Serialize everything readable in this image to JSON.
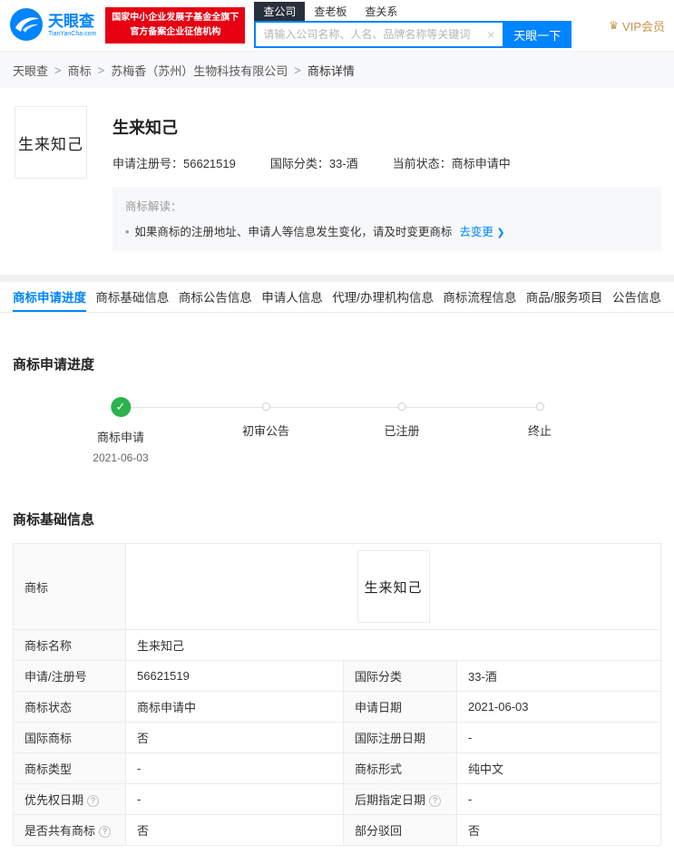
{
  "colors": {
    "brand_blue": "#0084ff",
    "badge_red": "#e60012",
    "vip_gold": "#c8954b",
    "success_green": "#2bb24c",
    "link_blue": "#0084ff"
  },
  "header": {
    "logo": {
      "name": "天眼查",
      "domain": "TianYanCha.com"
    },
    "badge": {
      "line1": "国家中小企业发展子基金全旗下",
      "line2": "官方备案企业征信机构"
    },
    "search": {
      "tabs": [
        {
          "label": "查公司"
        },
        {
          "label": "查老板"
        },
        {
          "label": "查关系"
        }
      ],
      "placeholder": "请输入公司名称、人名、品牌名称等关键词",
      "clear_icon": "×",
      "button": "天眼一下"
    },
    "vip": {
      "icon": "♛",
      "label": "VIP会员"
    }
  },
  "breadcrumb": {
    "separator": ">",
    "items": [
      {
        "label": "天眼查"
      },
      {
        "label": "商标"
      },
      {
        "label": "苏梅香（苏州）生物科技有限公司"
      },
      {
        "label": "商标详情"
      }
    ]
  },
  "summary": {
    "thumb_text": "生来知己",
    "title": "生来知己",
    "meta": [
      {
        "label": "申请注册号：",
        "value": "56621519"
      },
      {
        "label": "国际分类：",
        "value": "33-酒"
      },
      {
        "label": "当前状态：",
        "value": "商标申请中"
      }
    ],
    "tip": {
      "title": "商标解读：",
      "bullet": "•",
      "text": "如果商标的注册地址、申请人等信息发生变化，请及时变更商标",
      "link": "去变更",
      "link_arrow": "❯"
    }
  },
  "tabs": [
    {
      "label": "商标申请进度"
    },
    {
      "label": "商标基础信息"
    },
    {
      "label": "商标公告信息"
    },
    {
      "label": "申请人信息"
    },
    {
      "label": "代理/办理机构信息"
    },
    {
      "label": "商标流程信息"
    },
    {
      "label": "商品/服务项目"
    },
    {
      "label": "公告信息"
    }
  ],
  "progress": {
    "section_title": "商标申请进度",
    "check_glyph": "✓",
    "steps": [
      {
        "label": "商标申请",
        "date": "2021-06-03"
      },
      {
        "label": "初审公告",
        "date": ""
      },
      {
        "label": "已注册",
        "date": ""
      },
      {
        "label": "终止",
        "date": ""
      }
    ]
  },
  "basic_info": {
    "section_title": "商标基础信息",
    "trademark_label": "商标",
    "trademark_image_text": "生来知己",
    "name_label": "商标名称",
    "name_value": "生来知己",
    "help_icon": "?",
    "rows": [
      {
        "l1": "申请/注册号",
        "v1": "56621519",
        "l2": "国际分类",
        "v2": "33-酒"
      },
      {
        "l1": "商标状态",
        "v1": "商标申请中",
        "l2": "申请日期",
        "v2": "2021-06-03"
      },
      {
        "l1": "国际商标",
        "v1": "否",
        "l2": "国际注册日期",
        "v2": "-"
      },
      {
        "l1": "商标类型",
        "v1": "-",
        "l2": "商标形式",
        "v2": "纯中文"
      },
      {
        "l1": "优先权日期",
        "v1": "-",
        "l2": "后期指定日期",
        "v2": "-"
      },
      {
        "l1": "是否共有商标",
        "v1": "否",
        "l2": "部分驳回",
        "v2": "否"
      }
    ]
  }
}
